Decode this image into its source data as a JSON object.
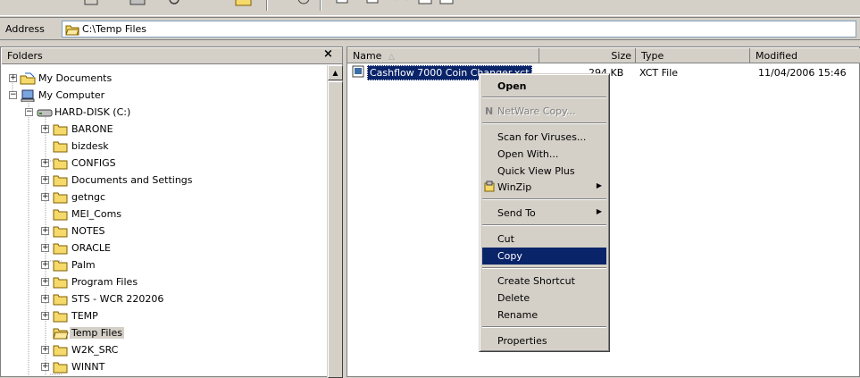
{
  "address": {
    "label": "Address",
    "value": "C:\\Temp Files"
  },
  "folders": {
    "title": "Folders",
    "close": "×",
    "tree": [
      {
        "label": "My Documents"
      },
      {
        "label": "My Computer"
      },
      {
        "label": "HARD-DISK (C:)"
      },
      {
        "label": "BARONE"
      },
      {
        "label": "bizdesk"
      },
      {
        "label": "CONFIGS"
      },
      {
        "label": "Documents and Settings"
      },
      {
        "label": "getngc"
      },
      {
        "label": "MEI_Coms"
      },
      {
        "label": "NOTES"
      },
      {
        "label": "ORACLE"
      },
      {
        "label": "Palm"
      },
      {
        "label": "Program Files"
      },
      {
        "label": "STS - WCR 220206"
      },
      {
        "label": "TEMP"
      },
      {
        "label": "Temp Files"
      },
      {
        "label": "W2K_SRC"
      },
      {
        "label": "WINNT"
      }
    ]
  },
  "files": {
    "columns": {
      "name": "Name",
      "size": "Size",
      "type": "Type",
      "modified": "Modified"
    },
    "rows": [
      {
        "name": "Cashflow 7000 Coin Changer.xct",
        "size": "294 KB",
        "type": "XCT File",
        "modified": "11/04/2006 15:46"
      }
    ]
  },
  "context_menu": {
    "open": "Open",
    "netware_copy": "NetWare Copy...",
    "scan": "Scan for Viruses...",
    "open_with": "Open With...",
    "quick_view": "Quick View Plus",
    "winzip": "WinZip",
    "send_to": "Send To",
    "cut": "Cut",
    "copy": "Copy",
    "create_shortcut": "Create Shortcut",
    "delete": "Delete",
    "rename": "Rename",
    "properties": "Properties"
  },
  "colors": {
    "selection": "#0a246a",
    "chrome": "#d4d0c8",
    "folder": "#f5d96b"
  }
}
